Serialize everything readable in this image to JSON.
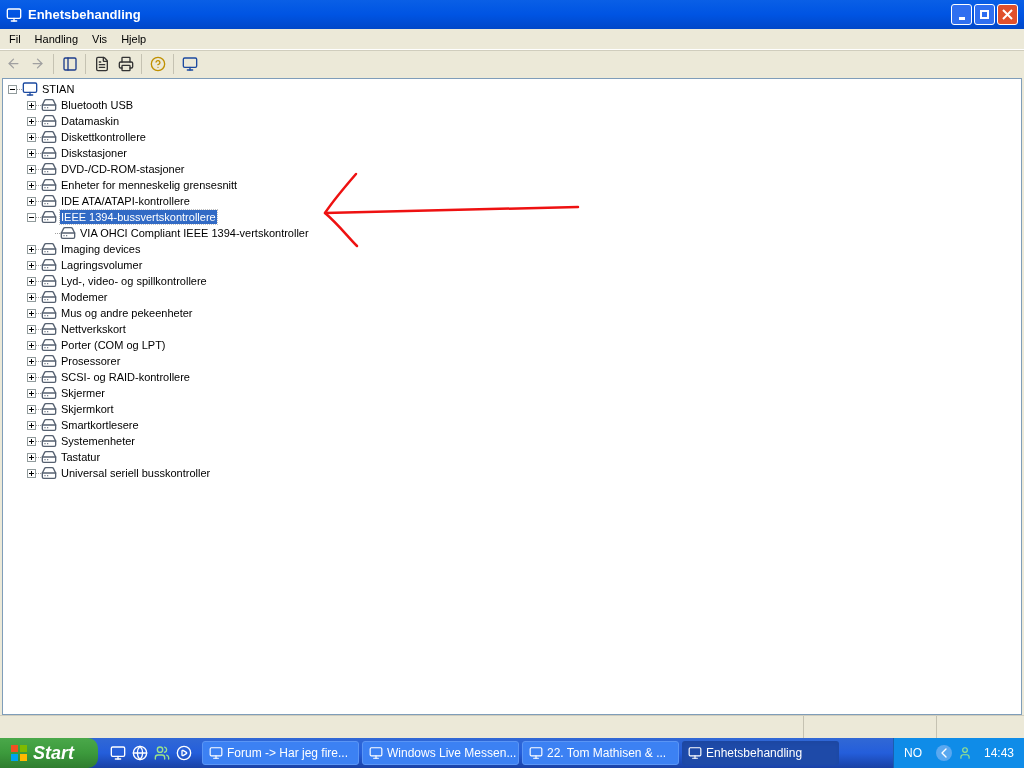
{
  "window": {
    "title": "Enhetsbehandling"
  },
  "menu": [
    "Fil",
    "Handling",
    "Vis",
    "Hjelp"
  ],
  "tree": {
    "label": "STIAN",
    "expanded": true,
    "selected": false,
    "children": [
      {
        "label": "Bluetooth USB",
        "expanded": false,
        "selected": false
      },
      {
        "label": "Datamaskin",
        "expanded": false,
        "selected": false
      },
      {
        "label": "Diskettkontrollere",
        "expanded": false,
        "selected": false
      },
      {
        "label": "Diskstasjoner",
        "expanded": false,
        "selected": false
      },
      {
        "label": "DVD-/CD-ROM-stasjoner",
        "expanded": false,
        "selected": false
      },
      {
        "label": "Enheter for menneskelig grensesnitt",
        "expanded": false,
        "selected": false
      },
      {
        "label": "IDE ATA/ATAPI-kontrollere",
        "expanded": false,
        "selected": false
      },
      {
        "label": "IEEE 1394-bussvertskontrollere",
        "expanded": true,
        "selected": true,
        "children": [
          {
            "label": "VIA OHCI Compliant IEEE 1394-vertskontroller",
            "selected": false
          }
        ]
      },
      {
        "label": "Imaging devices",
        "expanded": false,
        "selected": false
      },
      {
        "label": "Lagringsvolumer",
        "expanded": false,
        "selected": false
      },
      {
        "label": "Lyd-, video- og spillkontrollere",
        "expanded": false,
        "selected": false
      },
      {
        "label": "Modemer",
        "expanded": false,
        "selected": false
      },
      {
        "label": "Mus og andre pekeenheter",
        "expanded": false,
        "selected": false
      },
      {
        "label": "Nettverkskort",
        "expanded": false,
        "selected": false
      },
      {
        "label": "Porter (COM og LPT)",
        "expanded": false,
        "selected": false
      },
      {
        "label": "Prosessorer",
        "expanded": false,
        "selected": false
      },
      {
        "label": "SCSI- og RAID-kontrollere",
        "expanded": false,
        "selected": false
      },
      {
        "label": "Skjermer",
        "expanded": false,
        "selected": false
      },
      {
        "label": "Skjermkort",
        "expanded": false,
        "selected": false
      },
      {
        "label": "Smartkortlesere",
        "expanded": false,
        "selected": false
      },
      {
        "label": "Systemenheter",
        "expanded": false,
        "selected": false
      },
      {
        "label": "Tastatur",
        "expanded": false,
        "selected": false
      },
      {
        "label": "Universal seriell busskontroller",
        "expanded": false,
        "selected": false
      }
    ]
  },
  "taskbar": {
    "start": "Start",
    "tasks": [
      {
        "label": "Forum -> Har jeg fire...",
        "selected": false
      },
      {
        "label": "Windows Live Messen...",
        "selected": false
      },
      {
        "label": "22. Tom Mathisen & ...",
        "selected": false
      },
      {
        "label": "Enhetsbehandling",
        "selected": true
      }
    ],
    "language": "NO",
    "clock": "14:43"
  }
}
